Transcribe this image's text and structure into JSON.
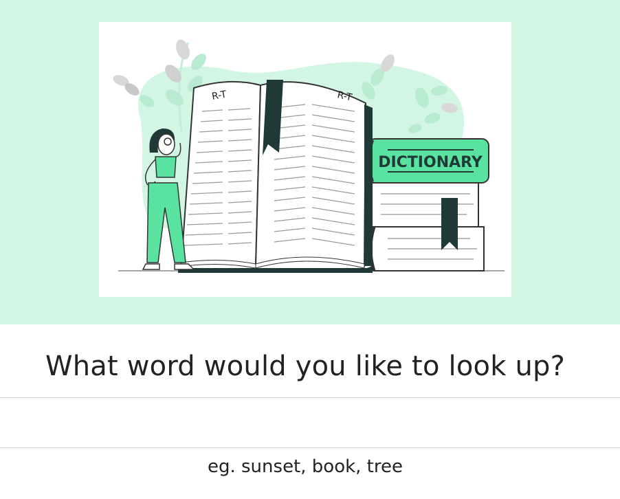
{
  "illustration": {
    "page_header_left": "R-T",
    "page_header_right": "R-T",
    "book_cover_title": "DICTIONARY",
    "accent_color": "#5ae3a0",
    "background_color": "#d3f5e4"
  },
  "main": {
    "prompt": "What word would you like to look up?",
    "search": {
      "value": "",
      "placeholder": ""
    },
    "hint": "eg. sunset, book, tree"
  }
}
